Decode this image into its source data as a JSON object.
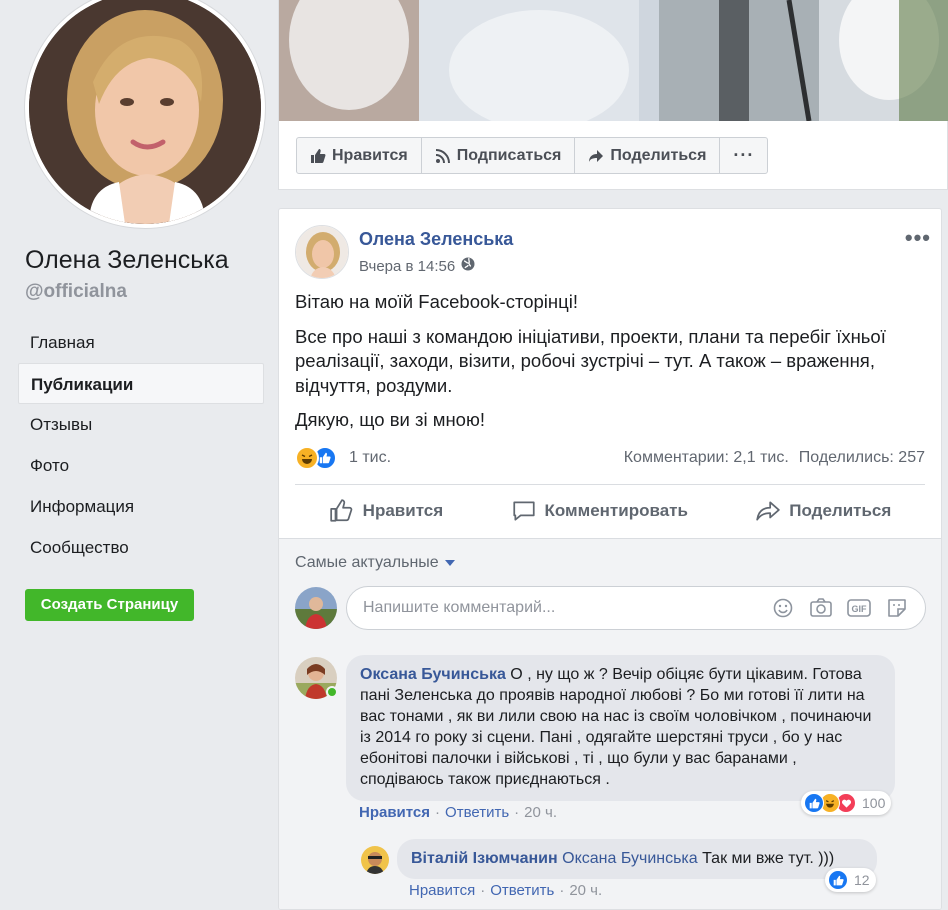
{
  "left": {
    "page_name": "Олена Зеленська",
    "handle": "@officialna",
    "nav": [
      "Главная",
      "Публикации",
      "Отзывы",
      "Фото",
      "Информация",
      "Сообщество"
    ],
    "create_button": "Создать Страницу"
  },
  "cover": {
    "actions": {
      "like": "Нравится",
      "follow": "Подписаться",
      "share": "Поделиться",
      "more": "···"
    }
  },
  "post": {
    "author": "Олена Зеленська",
    "time": "Вчера в 14:56",
    "more": "•••",
    "paragraphs": [
      "Вітаю на моїй Facebook-сторінці!",
      "Все про наші з командою ініціативи, проекти, плани та перебіг їхньої реалізації, заходи, візити, робочі зустрічі – тут. А також – враження, відчуття, роздуми.",
      "Дякую, що ви зі мною!"
    ],
    "reactions_count": "1 тис.",
    "comments_count": "Комментарии: 2,1 тис.",
    "shares_count": "Поделились: 257",
    "actions": {
      "like": "Нравится",
      "comment": "Комментировать",
      "share": "Поделиться"
    }
  },
  "comments": {
    "sort_label": "Самые актуальные",
    "input_placeholder": "Напишите комментарий...",
    "items": [
      {
        "author": "Оксана Бучинська",
        "text": " О , ну що ж ? Вечір обіцяє бути цікавим. Готова пані Зеленська до проявів народної любові ? Бо ми готові її лити на вас тонами , як ви лили свою на нас із своїм чоловічком , починаючи із 2014 го року зі сцени. Пані , одягайте шерстяні труси , бо у нас ебонітові палочки і військові , ті , що були у вас баранами , сподіваюсь також приєднаються .",
        "like": "Нравится",
        "reply": "Ответить",
        "sep": "·",
        "time": "20 ч.",
        "reactions": "100"
      },
      {
        "author": "Віталій Ізюмчанин",
        "mention": "Оксана Бучинська",
        "text": " Так ми вже тут. )))",
        "like": "Нравится",
        "reply": "Ответить",
        "sep": "·",
        "time": "20 ч.",
        "reactions": "12"
      }
    ]
  },
  "colors": {
    "link": "#385898",
    "green": "#42b72a",
    "like_blue": "#1877f2",
    "love_red": "#f33e58",
    "haha_yellow": "#f7b125"
  }
}
